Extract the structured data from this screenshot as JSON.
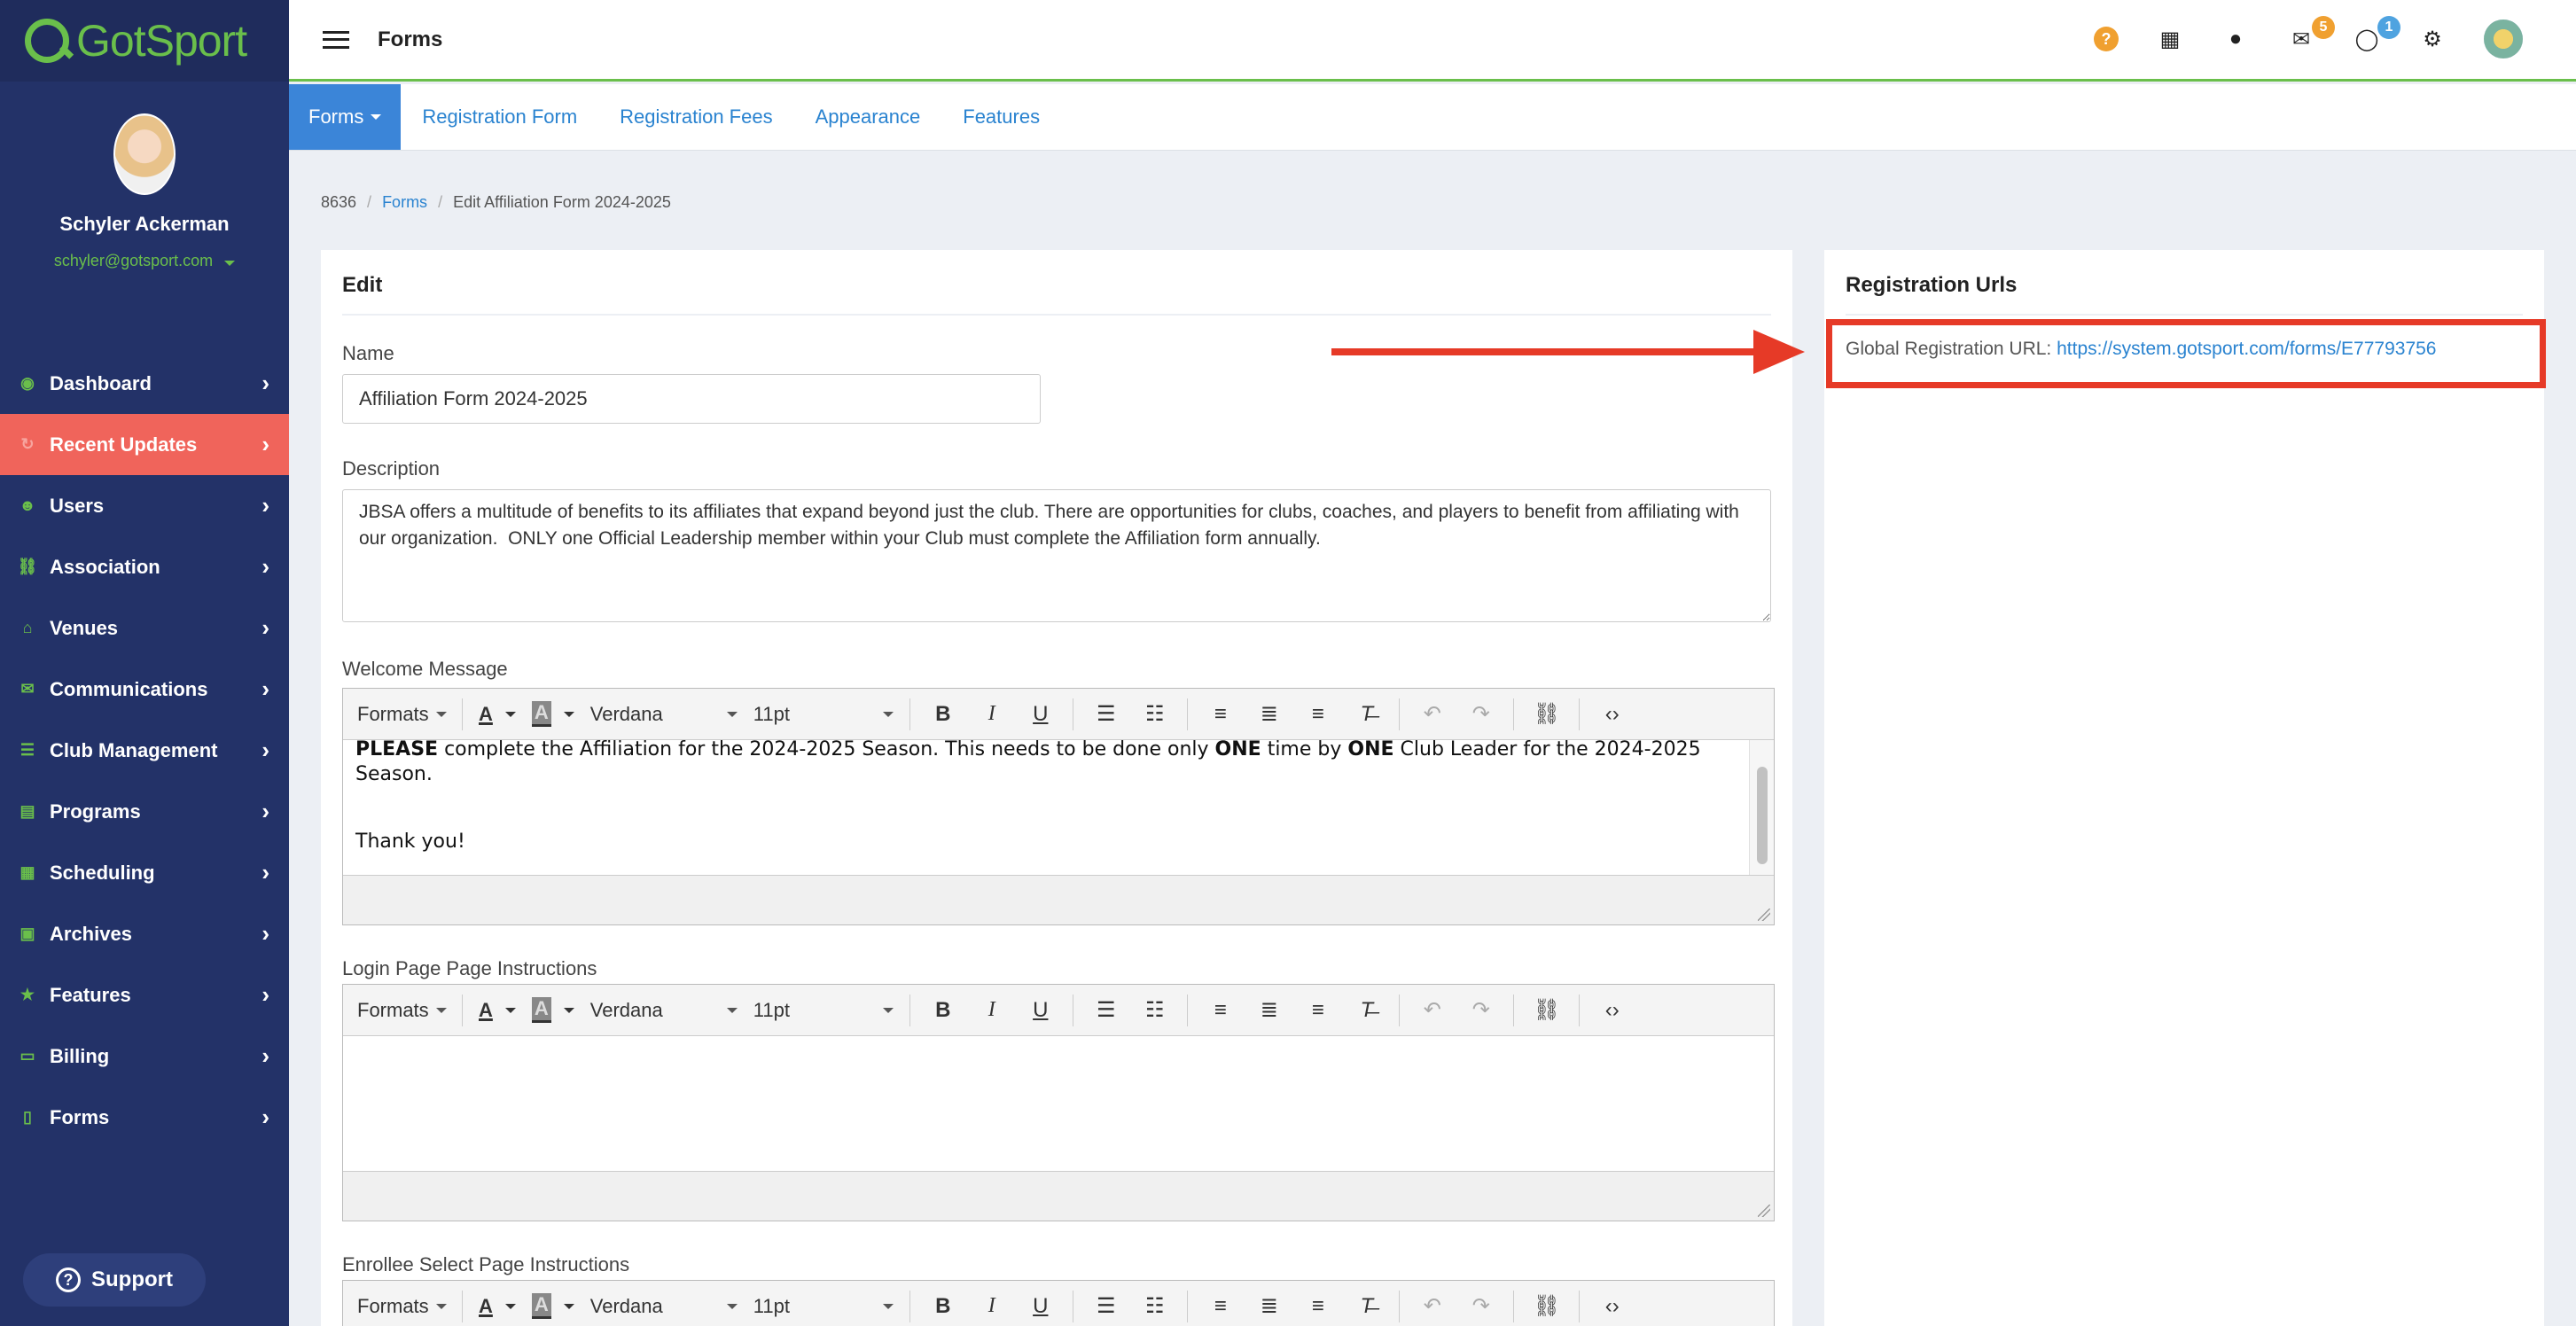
{
  "brand": {
    "name": "GotSport"
  },
  "user": {
    "name": "Schyler Ackerman",
    "email": "schyler@gotsport.com"
  },
  "sidebar": {
    "items": [
      {
        "label": "Dashboard",
        "icon": "dashboard-icon",
        "glyph": "◉"
      },
      {
        "label": "Recent Updates",
        "icon": "refresh-icon",
        "glyph": "↻"
      },
      {
        "label": "Users",
        "icon": "users-icon",
        "glyph": "☻"
      },
      {
        "label": "Association",
        "icon": "sitemap-icon",
        "glyph": "⛓"
      },
      {
        "label": "Venues",
        "icon": "home-icon",
        "glyph": "⌂"
      },
      {
        "label": "Communications",
        "icon": "comments-icon",
        "glyph": "✉"
      },
      {
        "label": "Club Management",
        "icon": "list-icon",
        "glyph": "☰"
      },
      {
        "label": "Programs",
        "icon": "file-icon",
        "glyph": "▤"
      },
      {
        "label": "Scheduling",
        "icon": "calendar-icon",
        "glyph": "▦"
      },
      {
        "label": "Archives",
        "icon": "archive-icon",
        "glyph": "▣"
      },
      {
        "label": "Features",
        "icon": "star-icon",
        "glyph": "★"
      },
      {
        "label": "Billing",
        "icon": "credit-card-icon",
        "glyph": "▭"
      },
      {
        "label": "Forms",
        "icon": "file-text-icon",
        "glyph": "▯"
      }
    ],
    "active_index": 1,
    "support_label": "Support"
  },
  "header": {
    "title": "Forms",
    "badges": {
      "messages": "5",
      "chat": "1"
    }
  },
  "tabs": [
    {
      "label": "Forms",
      "active": true,
      "dropdown": true
    },
    {
      "label": "Registration Form"
    },
    {
      "label": "Registration Fees"
    },
    {
      "label": "Appearance"
    },
    {
      "label": "Features"
    }
  ],
  "breadcrumb": {
    "root": "8636",
    "section": "Forms",
    "current": "Edit Affiliation Form 2024-2025"
  },
  "edit": {
    "title": "Edit",
    "name_label": "Name",
    "name_value": "Affiliation Form 2024-2025",
    "description_label": "Description",
    "description_value": "JBSA offers a multitude of benefits to its affiliates that expand beyond just the club. There are opportunities for clubs, coaches, and players to benefit from affiliating with our organization.  ONLY one Official Leadership member within your Club must complete the Affiliation form annually.",
    "welcome_label": "Welcome Message",
    "welcome": {
      "p1_a": "PLEASE",
      "p1_b": " complete the Affiliation for the 2024-2025 Season. This needs to be done only ",
      "p1_c": "ONE",
      "p1_d": " time by ",
      "p1_e": "ONE",
      "p1_f": " Club Leader for the 2024-2025 Season.",
      "p2": "Thank you!"
    },
    "login_label": "Login Page Page Instructions",
    "enrollee_label": "Enrollee Select Page Instructions"
  },
  "toolbar": {
    "formats": "Formats",
    "font": "Verdana",
    "size": "11pt",
    "text_color_glyph": "A",
    "bg_color_glyph": "A",
    "bold": "B",
    "italic": "I",
    "underline": "U"
  },
  "registration": {
    "title": "Registration Urls",
    "global_label": "Global Registration URL: ",
    "global_url": "https://system.gotsport.com/forms/E77793756"
  },
  "colors": {
    "sidebar": "#233268",
    "accent_green": "#6abf4b",
    "active_item": "#f0645b",
    "link": "#2a83d0",
    "annotation_red": "#e63a27"
  }
}
